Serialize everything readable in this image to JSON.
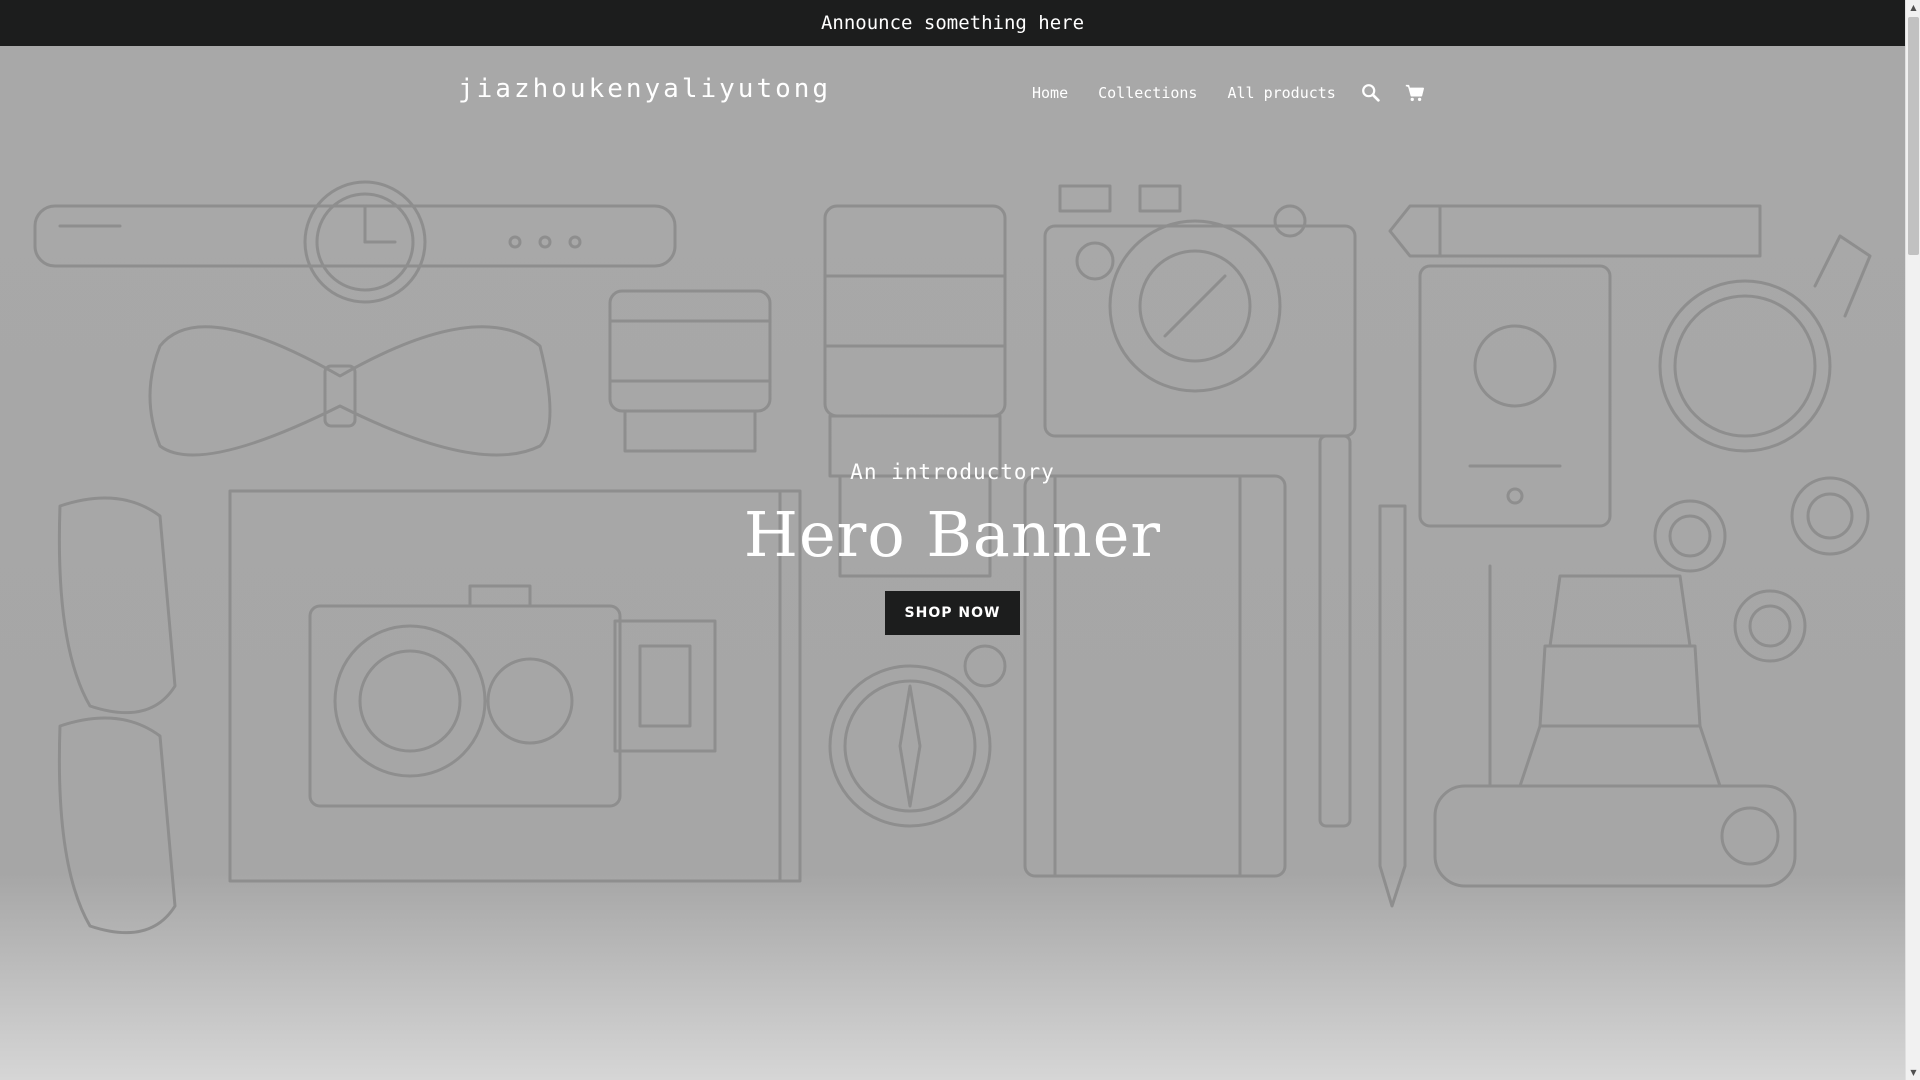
{
  "announcement": {
    "text": "Announce something here"
  },
  "header": {
    "logo": "jiazhoukenyaliyutong",
    "nav": [
      {
        "label": "Home"
      },
      {
        "label": "Collections"
      },
      {
        "label": "All products"
      }
    ],
    "icons": {
      "search": "search-icon",
      "cart": "cart-icon"
    }
  },
  "hero": {
    "subtitle": "An introductory",
    "title": "Hero Banner",
    "button_label": "SHOP NOW"
  },
  "colors": {
    "announce_bg": "#1c1d1d",
    "button_bg": "#1c1d1d",
    "overlay_gray": "#a8a8a8",
    "line_art": "#8e8e8e"
  }
}
